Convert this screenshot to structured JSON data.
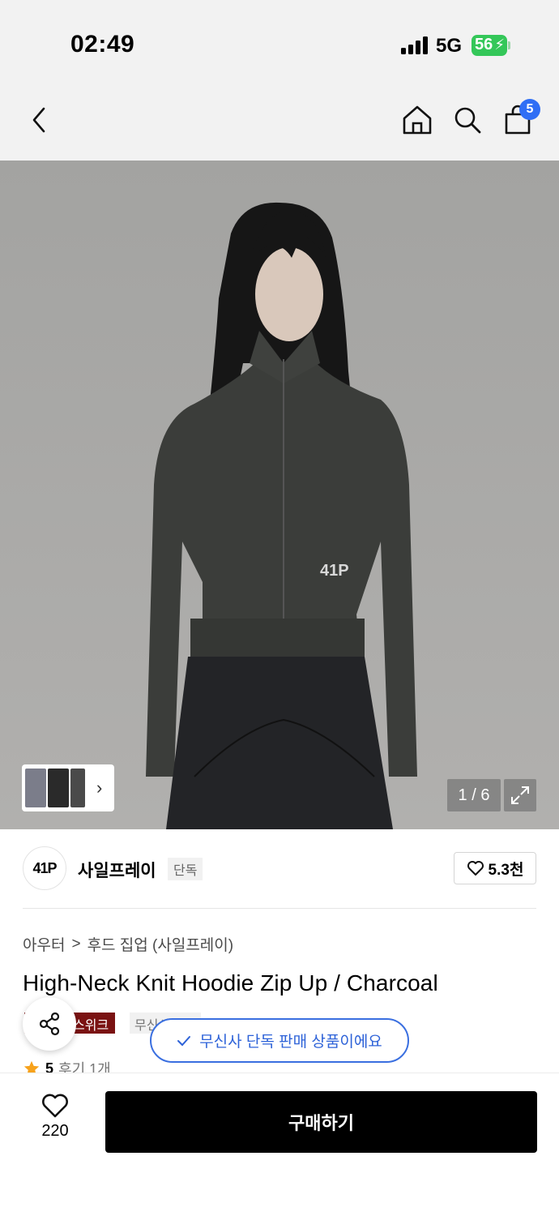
{
  "status_bar": {
    "time": "02:49",
    "network": "5G",
    "battery": "56"
  },
  "nav": {
    "cart_count": "5"
  },
  "gallery": {
    "page_indicator": "1 / 6"
  },
  "brand": {
    "logo_text": "41P",
    "name": "사일프레이",
    "tag": "단독",
    "likes": "5.3천"
  },
  "breadcrumb": {
    "category": "아우터",
    "separator": ">",
    "subcategory": "후드 집업 (사일프레이)"
  },
  "product": {
    "title": "High-Neck Knit Hoodie Zip Up / Charcoal",
    "tag_sale": "스위크",
    "tag_musinsa": "무신사단독"
  },
  "toast": {
    "message": "무신사 단독 판매 상품이에요"
  },
  "rating": {
    "score": "5",
    "review_label": "후기 1개"
  },
  "bottom": {
    "wish_count": "220",
    "buy_label": "구매하기"
  },
  "colors": {
    "accent": "#2f6ef5",
    "sale_tag": "#7a1212",
    "toast_blue": "#3a6fe0"
  }
}
